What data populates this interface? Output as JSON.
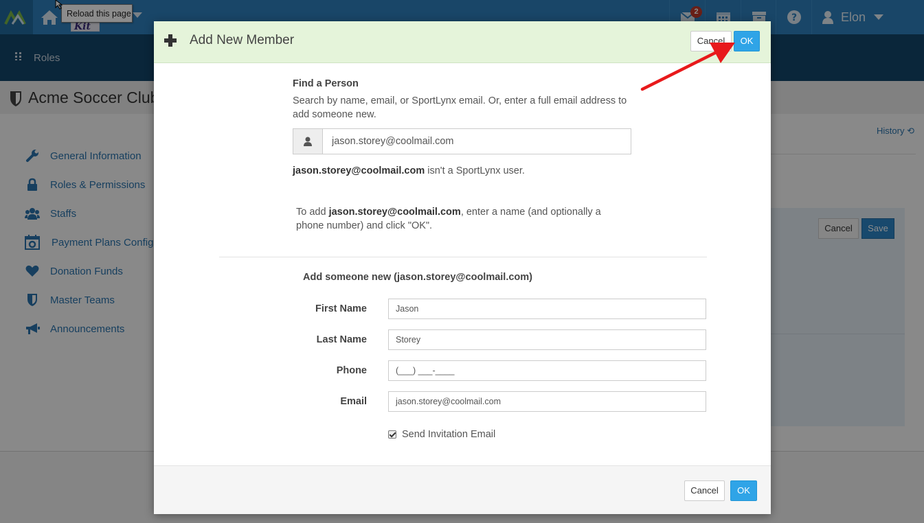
{
  "topbar": {
    "tooltip": "Reload this page",
    "message_badge": "2",
    "user_name": "Elon",
    "icons": [
      "logo-icon",
      "home-icon",
      "envelope-icon",
      "calendar-icon",
      "archive-icon",
      "help-icon",
      "user-icon"
    ]
  },
  "subnav": {
    "title": "Roles"
  },
  "page": {
    "club_name": "Acme Soccer Club",
    "history_label": "History",
    "sidebar": [
      {
        "label": "General Information",
        "icon": "wrench-icon"
      },
      {
        "label": "Roles & Permissions",
        "icon": "lock-icon"
      },
      {
        "label": "Staffs",
        "icon": "users-icon"
      },
      {
        "label": "Payment Plans Configu",
        "icon": "calendar-gear-icon"
      },
      {
        "label": "Donation Funds",
        "icon": "heart-icon"
      },
      {
        "label": "Master Teams",
        "icon": "shield-icon"
      },
      {
        "label": "Announcements",
        "icon": "bullhorn-icon"
      }
    ],
    "cancel_label": "Cancel",
    "save_label": "Save"
  },
  "modal": {
    "title": "Add New Member",
    "header_cancel": "Cancel",
    "header_ok": "OK",
    "find_label": "Find a Person",
    "find_help": "Search by name, email, or SportLynx email. Or, enter a full email address to add someone new.",
    "search_value": "jason.storey@coolmail.com",
    "not_user_email": "jason.storey@coolmail.com",
    "not_user_text": " isn't a SportLynx user.",
    "instr_prefix": "To add ",
    "instr_email": "jason.storey@coolmail.com",
    "instr_suffix": ", enter a name (and optionally a phone number) and click \"OK\".",
    "new_section_title": "Add someone new (jason.storey@coolmail.com)",
    "fields": {
      "first_name_label": "First Name",
      "first_name_value": "Jason",
      "last_name_label": "Last Name",
      "last_name_value": "Storey",
      "phone_label": "Phone",
      "phone_value": "(___) ___-____",
      "email_label": "Email",
      "email_value": "jason.storey@coolmail.com"
    },
    "send_invitation_label": "Send Invitation Email",
    "send_invitation_checked": true,
    "footer_cancel": "Cancel",
    "footer_ok": "OK"
  },
  "colors": {
    "topbar": "#2e80be",
    "subnav": "#13456b",
    "modal_header": "#e5f4da",
    "ok_button": "#2fa4e7",
    "arrow": "#e8191b"
  }
}
